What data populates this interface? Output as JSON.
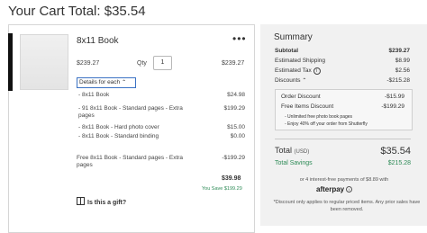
{
  "cart_title": "Your Cart Total: $35.54",
  "item": {
    "name": "8x11 Book",
    "menu_icon": "•••",
    "unit_price": "$239.27",
    "qty_label": "Qty",
    "qty_value": "1",
    "line_total": "$239.27",
    "details_label": "Details for each",
    "details_rows": [
      {
        "label": "- 8x11 Book",
        "value": "$24.98"
      },
      {
        "label": "- 91 8x11 Book - Standard pages - Extra pages",
        "value": "$199.29"
      },
      {
        "label": "- 8x11 Book - Hard photo cover",
        "value": "$15.00"
      },
      {
        "label": "- 8x11 Book - Standard binding",
        "value": "$0.00"
      }
    ],
    "free_row": {
      "label": "Free 8x11 Book - Standard pages - Extra pages",
      "value": "-$199.29"
    },
    "item_total": "$39.98",
    "you_save": "You Save $199.29",
    "gift_label": "Is this a gift?"
  },
  "summary": {
    "title": "Summary",
    "subtotal": {
      "label": "Subtotal",
      "value": "$239.27"
    },
    "shipping": {
      "label": "Estimated Shipping",
      "value": "$8.99"
    },
    "tax": {
      "label": "Estimated Tax",
      "value": "$2.56"
    },
    "discounts": {
      "label": "Discounts",
      "value": "-$215.28"
    },
    "order_discount": {
      "label": "Order Discount",
      "value": "-$15.99"
    },
    "free_items": {
      "label": "Free Items Discount",
      "value": "-$199.29"
    },
    "perks": [
      "- Unlimited free photo book pages",
      "- Enjoy 40% off your order from Shutterfly"
    ],
    "total": {
      "label": "Total",
      "currency": "(USD)",
      "value": "$35.54"
    },
    "savings": {
      "label": "Total Savings",
      "value": "$215.28"
    },
    "installments": "or 4 interest-free payments of $8.89 with",
    "afterpay": "afterpay",
    "disclaimer": "*Discount only applies to regular priced items. Any prior sales have been removed."
  },
  "colors": {
    "accent_blue": "#3b72c4",
    "savings_green": "#2e8b57",
    "panel_bg": "#f1f1f1"
  }
}
